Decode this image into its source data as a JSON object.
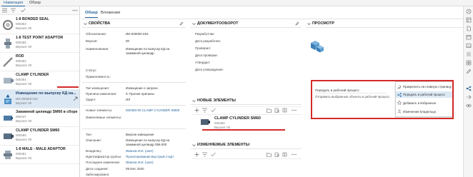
{
  "topbar": {
    "tabs": [
      "Навигация",
      "Обзор"
    ]
  },
  "nav": {
    "items": [
      {
        "title": "1-8 BONDED SEAL",
        "code": "000453",
        "version": "Версия: 00"
      },
      {
        "title": "1-8 TEST POINT ADAPTOR",
        "code": "000455",
        "version": "Версия: 00"
      },
      {
        "title": "ROD",
        "code": "000452",
        "version": "Версия: 00"
      },
      {
        "title": "CLAMP CYLINDER",
        "code": "000454",
        "version": "Версия: 00"
      },
      {
        "title": "Извещение по выпуску КД на...",
        "code": "ИИ.000000.015",
        "version": "Версия: 00"
      },
      {
        "title": "Зажимной цилиндр SM60 в сборе",
        "code": "000447",
        "version": "Версия: 00"
      },
      {
        "title": "CLAMP CYLINDER SM60",
        "code": "000450",
        "version": "Версия: 00"
      },
      {
        "title": "1-8 MALE - MALE ADAPTOR",
        "code": "000451",
        "version": "Версия: 00"
      }
    ]
  },
  "main": {
    "tabs": [
      "Обзор",
      "Вложения"
    ],
    "props": {
      "title": "СВОЙСТВА",
      "rows": [
        {
          "label": "Обозначение:",
          "value": "ИИ.000000.015"
        },
        {
          "label": "Версия:",
          "value": "00"
        },
        {
          "label": "Наименование:",
          "value": "Извещение по выпуску КД на зажимной цилиндр"
        },
        {
          "label": "Статус:",
          "value": ""
        },
        {
          "label": "Применяемость:",
          "value": ""
        },
        {
          "label": "Тип извещения:",
          "value": "Извещение о запуске"
        },
        {
          "label": "Причина изменения:",
          "value": "0: Прочие причины"
        },
        {
          "label": "Задел:",
          "value": "ИЛ"
        },
        {
          "label": "Новые элементы:",
          "value": "000450-00 CLAMP CYLINDER SM60"
        },
        {
          "label": "Изменяемые элементы:",
          "value": ""
        },
        {
          "label": "Тип:",
          "value": "Версия извещения"
        },
        {
          "label": "Описание:",
          "value": "Извещение по выпуску КД на зажимной цилиндр 058.000"
        },
        {
          "label": "Владелец:",
          "value": "Иванов И.И. (user)"
        },
        {
          "label": "Идентификатор группы:",
          "value": "Проектирование.Быстрый старт"
        },
        {
          "label": "Последнее изменение:",
          "value": "Иванов И.И. (user)"
        },
        {
          "label": "Дата создания:",
          "value": "09 Dec 2020"
        },
        {
          "label": "Заблокировано:",
          "value": ""
        }
      ]
    },
    "workflow": {
      "title": "ДОКУМЕНТООБОРОТ",
      "rows": [
        "Разработчик:",
        "Дата разработки:",
        "Проверил:",
        "Дата проверки:",
        "Утвердил:",
        "Дата утверждения:"
      ]
    },
    "new_items": {
      "title": "НОВЫЕ ЭЛЕМЕНТЫ",
      "item_title": "CLAMP CYLINDER SM60",
      "item_code": "000450",
      "item_version": "Версия: 00"
    },
    "changed_items": {
      "title": "ИЗМЕНЯЕМЫЕ ЭЛЕМЕНТЫ"
    },
    "preview": {
      "title": "ПРОСМОТР"
    },
    "workflow_panel": {
      "line1": "Передать в рабочий процесс",
      "line2": "Отправить выбранные объекты в рабочий процесс."
    },
    "context_menu": {
      "items": [
        "Прикрепить на главную страницу",
        "Передать в рабочий процесс",
        "Добавить в Избранное",
        "Изменение владельца"
      ]
    }
  },
  "colors": {
    "accent": "#1f5f9a",
    "highlight": "#d42a2a",
    "selection": "#dce9f5"
  }
}
